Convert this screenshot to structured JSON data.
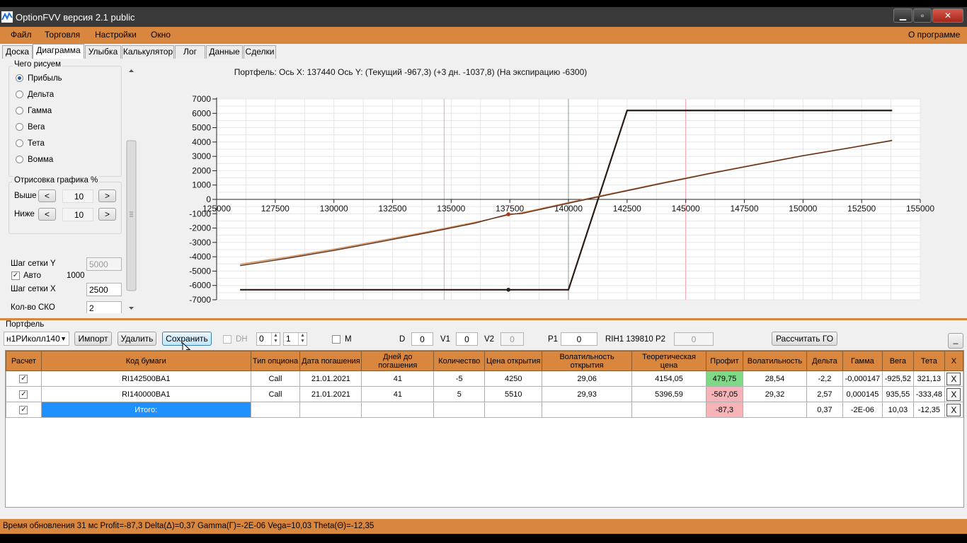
{
  "window": {
    "title": "OptionFVV версия 2.1 public",
    "min_label": "▁",
    "max_label": "▫",
    "close_label": "✕"
  },
  "menu": {
    "items": [
      "Файл",
      "Торговля",
      "Настройки",
      "Окно"
    ],
    "about": "О программе"
  },
  "tabs": [
    "Доска",
    "Диаграмма",
    "Улыбка",
    "Калькулятор",
    "Лог",
    "Данные",
    "Сделки"
  ],
  "left": {
    "draw_group": "Чего рисуем",
    "radios": [
      "Прибыль",
      "Дельта",
      "Гамма",
      "Вега",
      "Тета",
      "Вомма"
    ],
    "selected_radio": "Прибыль",
    "range_group": "Отрисовка графика %",
    "above_label": "Выше",
    "above_value": "10",
    "below_label": "Ниже",
    "below_value": "10",
    "prev_btn": "<",
    "next_btn": ">",
    "grid_y_label": "Шаг сетки Y",
    "grid_y_value": "5000",
    "auto_label": "Авто",
    "auto_value": "1000",
    "grid_x_label": "Шаг сетки X",
    "grid_x_value": "2500",
    "sko_label": "Кол-во СКО",
    "sko_value": "2"
  },
  "chart_data": {
    "type": "line",
    "title": "Портфель:  Ось X: 137440 Ось Y:   (Текущий -967,3)  (+3 дн. -1037,8)  (На экспирацию -6300)",
    "xlim": [
      125000,
      155000
    ],
    "ylim": [
      -7000,
      7000
    ],
    "xticks": [
      "125000",
      "127500",
      "130000",
      "132500",
      "135000",
      "137500",
      "140000",
      "142500",
      "145000",
      "147500",
      "150000",
      "152500",
      "155000"
    ],
    "yticks": [
      "7000",
      "6000",
      "5000",
      "4000",
      "3000",
      "2000",
      "1000",
      "0",
      "-1000",
      "-2000",
      "-3000",
      "-4000",
      "-5000",
      "-6000",
      "-7000"
    ],
    "vlines_pink": [
      134700,
      145000
    ],
    "vline_gray": 140000,
    "markers": [
      {
        "x": 137440,
        "y": -1037.8
      },
      {
        "x": 137440,
        "y": -6300
      }
    ],
    "series": [
      {
        "color": "#2b1a12",
        "x": [
          126000,
          140000,
          142500,
          153800
        ],
        "y": [
          -6300,
          -6300,
          6200,
          6200
        ]
      },
      {
        "color": "#d2905a",
        "x": [
          126000,
          128000,
          130000,
          132000,
          134000,
          136000,
          137440,
          138000,
          140000,
          142000,
          144000,
          146000,
          148000,
          150000,
          152000,
          153800
        ],
        "y": [
          -4520,
          -4020,
          -3470,
          -2870,
          -2250,
          -1600,
          -1100,
          -930,
          -220,
          470,
          1160,
          1820,
          2450,
          3060,
          3610,
          4130
        ]
      },
      {
        "color": "#5a2e1a",
        "x": [
          126000,
          128000,
          130000,
          132000,
          134000,
          136000,
          137440,
          138000,
          140000,
          142000,
          144000,
          146000,
          148000,
          150000,
          152000,
          153800
        ],
        "y": [
          -4620,
          -4110,
          -3560,
          -2950,
          -2320,
          -1660,
          -1040,
          -990,
          -270,
          430,
          1120,
          1790,
          2420,
          3040,
          3590,
          4100
        ]
      }
    ]
  },
  "portfolio": {
    "label": "Портфель",
    "select_value": "н1РИколл140",
    "import_btn": "Импорт",
    "delete_btn": "Удалить",
    "save_btn": "Сохранить",
    "dh_label": "DH",
    "spin1": "0",
    "spin2": "1",
    "m_label": "M",
    "d_label": "D",
    "d_value": "0",
    "v1_label": "V1",
    "v1_value": "0",
    "v2_label": "V2",
    "v2_value": "0",
    "p1_label": "P1",
    "p1_value": "0",
    "rih_label": "RIH1 139810",
    "p2_label": "P2",
    "p2_value": "0",
    "go_btn": "Рассчитать ГО",
    "min_btn": "_"
  },
  "table": {
    "headers": [
      "Расчет",
      "Код бумаги",
      "Тип опциона",
      "Дата погашения",
      "Дней до погашения",
      "Количество",
      "Цена открытия",
      "Волатильность открытия",
      "Теоретическая цена",
      "Профит",
      "Волатильность",
      "Дельта",
      "Гамма",
      "Вега",
      "Тета",
      "X"
    ],
    "rows": [
      [
        "✓",
        "RI142500BA1",
        "Call",
        "21.01.2021",
        "41",
        "-5",
        "4250",
        "29,06",
        "4154,05",
        "479,75",
        "28,54",
        "-2,2",
        "-0,000147",
        "-925,52",
        "321,13",
        "X"
      ],
      [
        "✓",
        "RI140000BA1",
        "Call",
        "21.01.2021",
        "41",
        "5",
        "5510",
        "29,93",
        "5396,59",
        "-567,05",
        "29,32",
        "2,57",
        "0,000145",
        "935,55",
        "-333,48",
        "X"
      ],
      [
        "✓",
        "Итого:",
        "",
        "",
        "",
        "",
        "",
        "",
        "",
        "-87,3",
        "",
        "0,37",
        "-2E-06",
        "10,03",
        "-12,35",
        "X"
      ]
    ]
  },
  "status": "Время обновления 31 мс  Profit=-87,3 Delta(Δ)=0,37 Gamma(Γ)=-2E-06 Vega=10,03 Theta(Θ)=-12,35"
}
